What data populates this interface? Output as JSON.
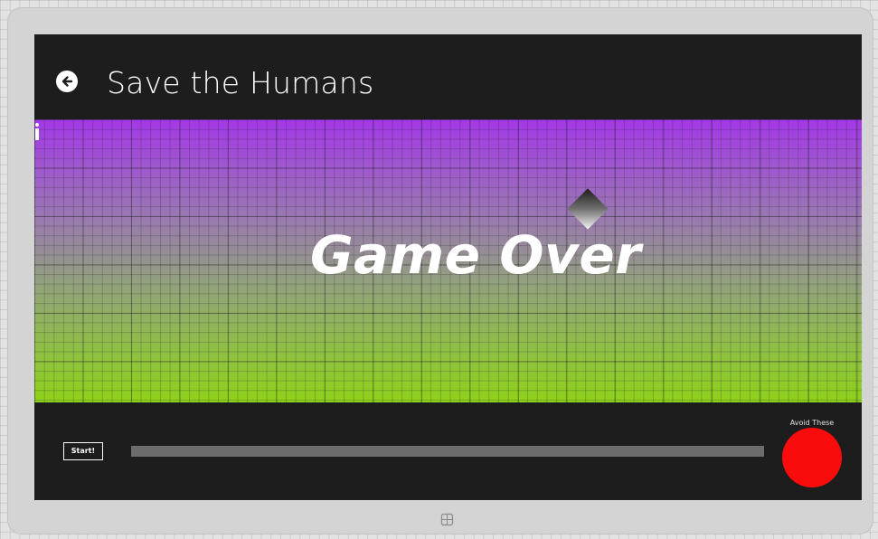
{
  "app": {
    "title": "Save the Humans"
  },
  "header": {
    "back_icon": "back-arrow-icon"
  },
  "play_area": {
    "game_over_text": "Game Over",
    "gradient_colors": [
      "#A438E8",
      "#8ED11A"
    ],
    "target_icon": "diamond-target",
    "human_icon": "human-figure"
  },
  "bottom_bar": {
    "start_label": "Start!",
    "progress": 1.0,
    "enemy_label": "Avoid These",
    "enemy_color": "#FB0C0C"
  },
  "device": {
    "windows_icon": "windows-logo-icon"
  }
}
